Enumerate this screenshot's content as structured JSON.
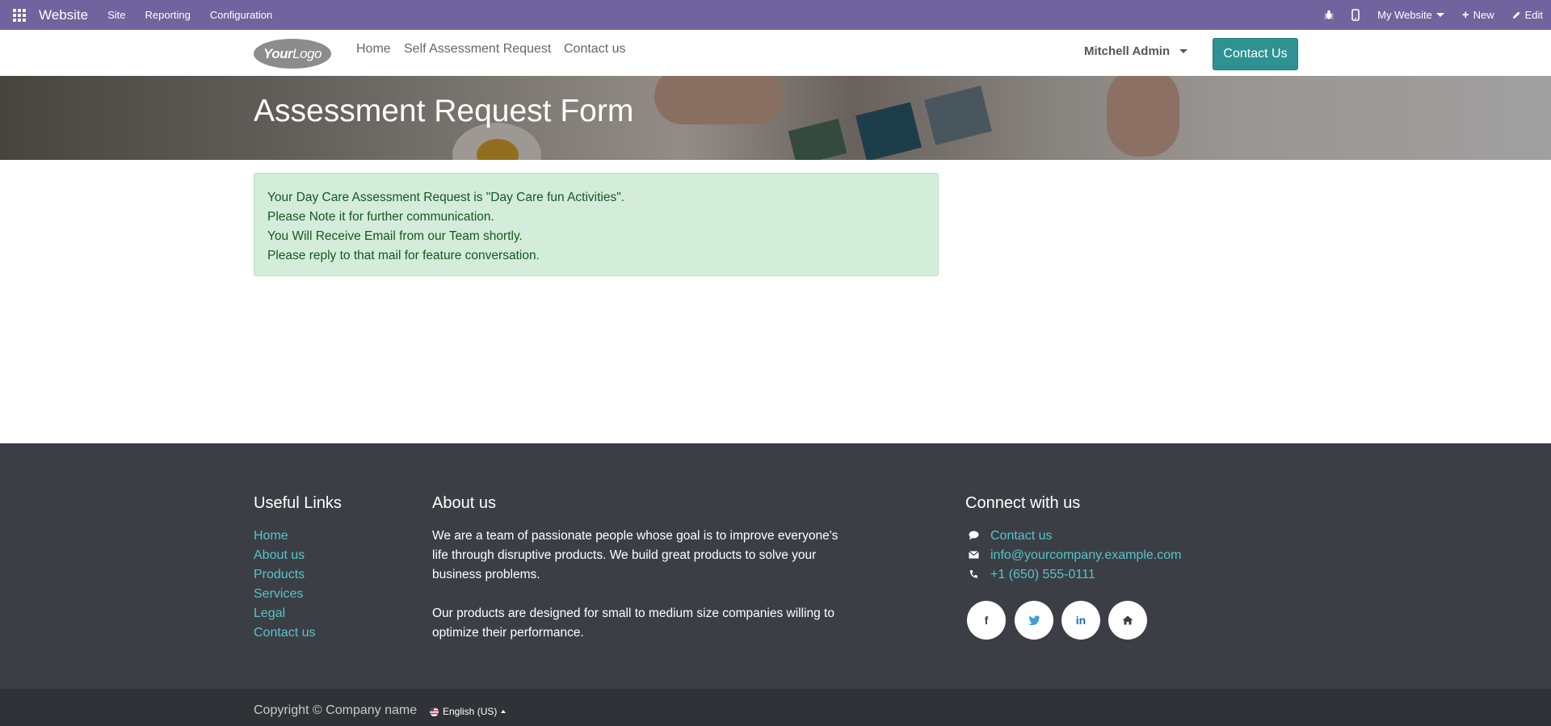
{
  "topbar": {
    "brand": "Website",
    "menus": [
      "Site",
      "Reporting",
      "Configuration"
    ],
    "website_selector": "My Website",
    "new_label": "New",
    "edit_label": "Edit"
  },
  "header": {
    "logo_bold": "Your",
    "logo_rest": "Logo",
    "nav": [
      "Home",
      "Self Assessment Request",
      "Contact us"
    ],
    "user": "Mitchell Admin",
    "cta": "Contact Us"
  },
  "banner": {
    "title": "Assessment Request Form"
  },
  "alert": {
    "lines": [
      "Your Day Care Assessment Request is \"Day Care fun Activities\".",
      "Please Note it for further communication.",
      "You Will Receive Email from our Team shortly.",
      "Please reply to that mail for feature conversation."
    ]
  },
  "footer": {
    "useful_links_title": "Useful Links",
    "useful_links": [
      "Home",
      "About us",
      "Products",
      "Services",
      "Legal",
      "Contact us"
    ],
    "about_title": "About us",
    "about_p1_lines": [
      "We are a team of passionate people whose goal is to improve everyone's",
      "life through disruptive products. We build great products to solve your",
      "business problems."
    ],
    "about_p2_lines": [
      "Our products are designed for small to medium size companies willing to",
      "optimize their performance."
    ],
    "connect_title": "Connect with us",
    "contact_link": "Contact us",
    "email": "info@yourcompany.example.com",
    "phone": "+1 (650) 555-0111",
    "socials": [
      "facebook-icon",
      "twitter-icon",
      "linkedin-icon",
      "home-icon"
    ]
  },
  "bottom": {
    "copyright": "Copyright © Company name",
    "language": "English (US)"
  },
  "colors": {
    "topbar": "#71639e",
    "cta": "#2f9292",
    "alert_bg": "#d4edda",
    "alert_text": "#155724",
    "footer_bg": "#3b3f45",
    "footer_link": "#57c3c9"
  }
}
